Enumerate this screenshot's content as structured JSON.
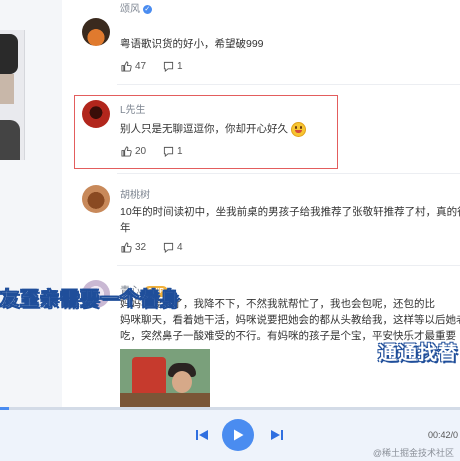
{
  "comments": [
    {
      "username": "颂风",
      "verified": true,
      "text": "粤语歌识货的好小，希望破999",
      "likes": "47",
      "replies": "1"
    },
    {
      "username": "L先生",
      "text": "别人只是无聊逗逗你，你却开心好久",
      "emoji": "grinning-emoji",
      "likes": "20",
      "replies": "1"
    },
    {
      "username": "胡桃树",
      "text_line1": "10年的时间读初中，坐我前桌的男孩子给我推荐了张敬轩推荐了村，真的很好听",
      "text_line2": "年",
      "likes": "32",
      "replies": "4"
    },
    {
      "username": "青心",
      "badge": "SVIP",
      "text_line1": "妈妈我要吃了，我降不下，不然我就帮忙了，我也会包呢，还包的比",
      "text_line2": "妈咪聊天，看着她干活，妈咪说要把她会的都从头教给我，这样等以后她老了做",
      "text_line3": "吃，突然鼻子一酸难受的不行。有妈咪的孩子是个宝，平安快乐才最重要"
    }
  ],
  "subtitles": {
    "line1": "友至亲需要一个替身",
    "line2": "通通找替"
  },
  "player": {
    "time": "00:42/0",
    "progress": 0.02
  },
  "watermark": "@稀土掘金技术社区",
  "colors": {
    "accent": "#4a8cf0",
    "highlight_border": "#e35d5d",
    "subtitle_outline": "#1f4e9a"
  }
}
